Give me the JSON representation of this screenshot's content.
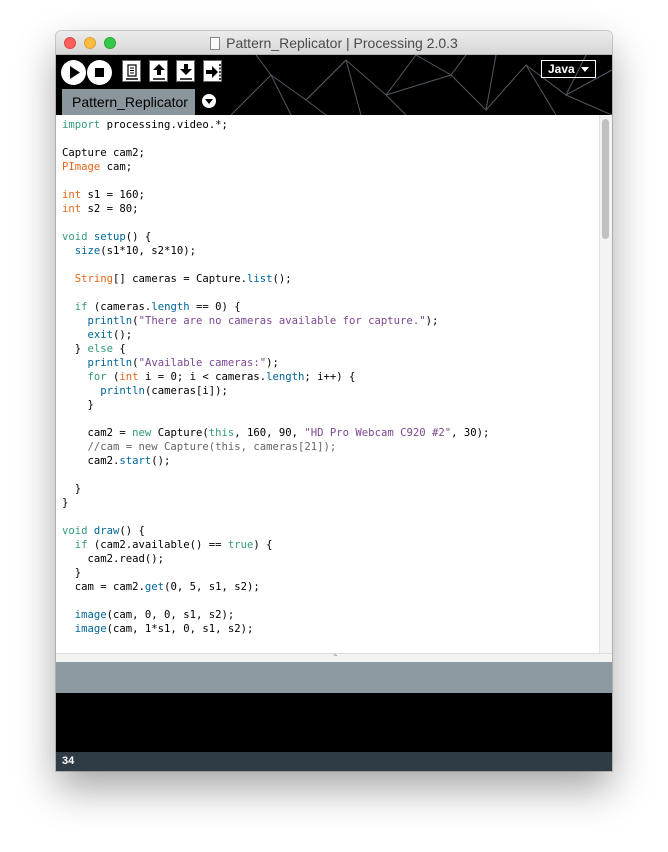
{
  "window": {
    "title": "Pattern_Replicator | Processing 2.0.3"
  },
  "toolbar": {
    "run_icon": "play-icon",
    "stop_icon": "stop-icon",
    "new_icon": "new-file-icon",
    "open_icon": "open-arrow-up-icon",
    "save_icon": "save-arrow-down-icon",
    "export_icon": "export-arrow-right-icon",
    "mode": "Java"
  },
  "tabs": [
    {
      "label": "Pattern_Replicator"
    }
  ],
  "editor": {
    "lines": [
      [
        {
          "t": "import",
          "c": "kw"
        },
        {
          "t": " processing.video.*;"
        }
      ],
      [],
      [
        {
          "t": "Capture cam2;"
        }
      ],
      [
        {
          "t": "PImage",
          "c": "ty"
        },
        {
          "t": " cam;"
        }
      ],
      [],
      [
        {
          "t": "int",
          "c": "ty"
        },
        {
          "t": " s1 = 160;"
        }
      ],
      [
        {
          "t": "int",
          "c": "ty"
        },
        {
          "t": " s2 = 80;"
        }
      ],
      [],
      [
        {
          "t": "void",
          "c": "kw"
        },
        {
          "t": " "
        },
        {
          "t": "setup",
          "c": "fn"
        },
        {
          "t": "() {"
        }
      ],
      [
        {
          "t": "  "
        },
        {
          "t": "size",
          "c": "fn"
        },
        {
          "t": "(s1*10, s2*10);"
        }
      ],
      [],
      [
        {
          "t": "  "
        },
        {
          "t": "String",
          "c": "ty"
        },
        {
          "t": "[] cameras = Capture."
        },
        {
          "t": "list",
          "c": "fn"
        },
        {
          "t": "();"
        }
      ],
      [],
      [
        {
          "t": "  "
        },
        {
          "t": "if",
          "c": "kw"
        },
        {
          "t": " (cameras."
        },
        {
          "t": "length",
          "c": "fn"
        },
        {
          "t": " == 0) {"
        }
      ],
      [
        {
          "t": "    "
        },
        {
          "t": "println",
          "c": "fn"
        },
        {
          "t": "("
        },
        {
          "t": "\"There are no cameras available for capture.\"",
          "c": "st"
        },
        {
          "t": ");"
        }
      ],
      [
        {
          "t": "    "
        },
        {
          "t": "exit",
          "c": "fn"
        },
        {
          "t": "();"
        }
      ],
      [
        {
          "t": "  } "
        },
        {
          "t": "else",
          "c": "kw"
        },
        {
          "t": " {"
        }
      ],
      [
        {
          "t": "    "
        },
        {
          "t": "println",
          "c": "fn"
        },
        {
          "t": "("
        },
        {
          "t": "\"Available cameras:\"",
          "c": "st"
        },
        {
          "t": ");"
        }
      ],
      [
        {
          "t": "    "
        },
        {
          "t": "for",
          "c": "kw"
        },
        {
          "t": " ("
        },
        {
          "t": "int",
          "c": "ty"
        },
        {
          "t": " i = 0; i < cameras."
        },
        {
          "t": "length",
          "c": "fn"
        },
        {
          "t": "; i++) {"
        }
      ],
      [
        {
          "t": "      "
        },
        {
          "t": "println",
          "c": "fn"
        },
        {
          "t": "(cameras[i]);"
        }
      ],
      [
        {
          "t": "    }"
        }
      ],
      [],
      [
        {
          "t": "    cam2 = "
        },
        {
          "t": "new",
          "c": "kw"
        },
        {
          "t": " Capture("
        },
        {
          "t": "this",
          "c": "kw"
        },
        {
          "t": ", 160, 90, "
        },
        {
          "t": "\"HD Pro Webcam C920 #2\"",
          "c": "st"
        },
        {
          "t": ", 30);"
        }
      ],
      [
        {
          "t": "    "
        },
        {
          "t": "//cam = new Capture(this, cameras[21]);",
          "c": "cm"
        }
      ],
      [
        {
          "t": "    cam2."
        },
        {
          "t": "start",
          "c": "fn"
        },
        {
          "t": "();"
        }
      ],
      [],
      [
        {
          "t": "  }"
        }
      ],
      [
        {
          "t": "}"
        }
      ],
      [],
      [
        {
          "t": "void",
          "c": "kw"
        },
        {
          "t": " "
        },
        {
          "t": "draw",
          "c": "fn"
        },
        {
          "t": "() {"
        }
      ],
      [
        {
          "t": "  "
        },
        {
          "t": "if",
          "c": "kw"
        },
        {
          "t": " (cam2.available() == "
        },
        {
          "t": "true",
          "c": "kw"
        },
        {
          "t": ") {"
        }
      ],
      [
        {
          "t": "    cam2.read();"
        }
      ],
      [
        {
          "t": "  }"
        }
      ],
      [
        {
          "t": "  cam = cam2."
        },
        {
          "t": "get",
          "c": "fn"
        },
        {
          "t": "(0, 5, s1, s2);"
        }
      ],
      [],
      [
        {
          "t": "  "
        },
        {
          "t": "image",
          "c": "fn"
        },
        {
          "t": "(cam, 0, 0, s1, s2);"
        }
      ],
      [
        {
          "t": "  "
        },
        {
          "t": "image",
          "c": "fn"
        },
        {
          "t": "(cam, 1*s1, 0, s1, s2);"
        }
      ]
    ]
  },
  "status": {
    "line_number": "34"
  },
  "colors": {
    "keyword": "#33997e",
    "type": "#e2661a",
    "function": "#006699",
    "string": "#7d4793",
    "comment": "#666666",
    "message_area": "#8e9aa2",
    "status_bar": "#2f3c45"
  }
}
